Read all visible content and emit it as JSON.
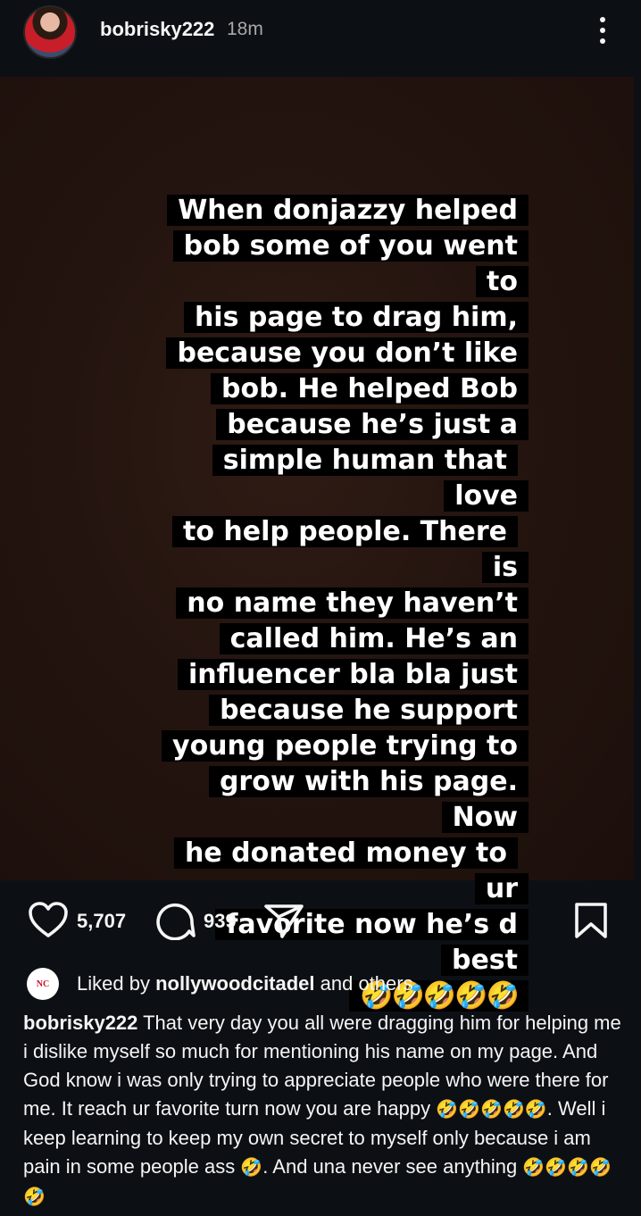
{
  "header": {
    "username": "bobrisky222",
    "time": "18m"
  },
  "story": {
    "lines": [
      "When donjazzy helped",
      "bob some of you went to",
      "his page to drag him,",
      "because you don’t like",
      "bob. He helped Bob",
      "because he’s just a",
      "simple human that love",
      "to help people. There is",
      "no name they haven’t",
      "called him. He’s an",
      "influencer bla bla just",
      "because he support",
      "young people trying to",
      "grow with his page. Now",
      "he donated  money to ur",
      "favorite now he’s d best"
    ],
    "emoji_line": "🤣🤣🤣🤣🤣"
  },
  "actions": {
    "like_count": "5,707",
    "comment_count": "939",
    "icons": [
      "heart-icon",
      "comment-icon",
      "share-icon",
      "bookmark-icon"
    ]
  },
  "likes": {
    "prefix": "Liked by ",
    "user": "nollywoodcitadel",
    "suffix": " and others",
    "avatar_text": "NC"
  },
  "caption": {
    "username": "bobrisky222",
    "text_1": " That very day you all were dragging him for helping me i dislike myself so much for mentioning his name on my page. And God know i was only trying to appreciate people who were there for me. It reach ur favorite turn now you are happy ",
    "emoji_1": "🤣🤣🤣🤣🤣",
    "text_2": ". Well i keep learning to keep my own secret to myself only because i am pain in some people ass ",
    "emoji_2": "🤣",
    "text_3": ". And una never see anything ",
    "emoji_3": "🤣🤣🤣🤣🤣"
  },
  "colors": {
    "background": "#0c1014",
    "story_background": "#24140f",
    "text_box": "#000000",
    "secondary_text": "#a8a8a8"
  }
}
